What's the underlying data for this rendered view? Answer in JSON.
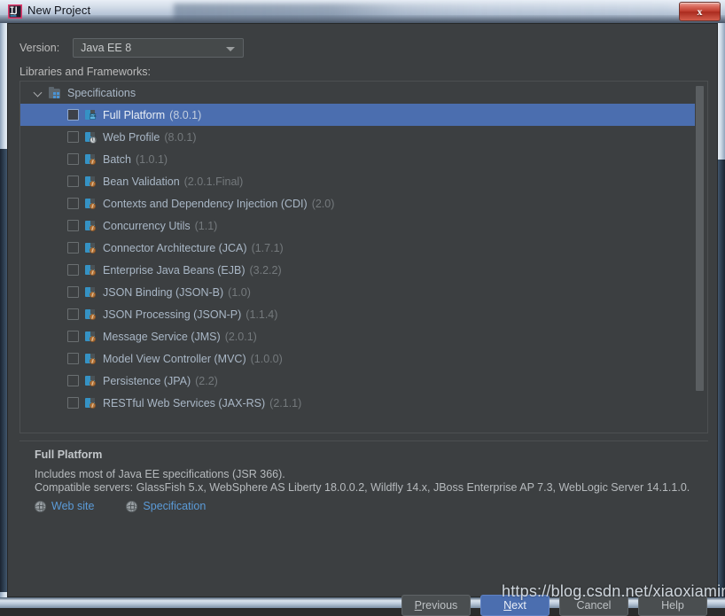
{
  "window": {
    "title": "New Project",
    "app_icon": "intellij-idea-icon",
    "close_label": "x"
  },
  "form": {
    "version_label": "Version:",
    "version_value": "Java EE 8",
    "libraries_label": "Libraries and Frameworks:"
  },
  "tree": {
    "group": {
      "label": "Specifications",
      "icon": "module-icon",
      "chevron": "chevron-down-icon"
    },
    "items": [
      {
        "name": "Full Platform",
        "version": "(8.0.1)",
        "icon": "platform-icon",
        "checked": false,
        "selected": true
      },
      {
        "name": "Web Profile",
        "version": "(8.0.1)",
        "icon": "web-profile-icon",
        "checked": false,
        "selected": false
      },
      {
        "name": "Batch",
        "version": "(1.0.1)",
        "icon": "spec-icon",
        "checked": false,
        "selected": false
      },
      {
        "name": "Bean Validation",
        "version": "(2.0.1.Final)",
        "icon": "spec-icon",
        "checked": false,
        "selected": false
      },
      {
        "name": "Contexts and Dependency Injection (CDI)",
        "version": "(2.0)",
        "icon": "spec-icon",
        "checked": false,
        "selected": false
      },
      {
        "name": "Concurrency Utils",
        "version": "(1.1)",
        "icon": "spec-icon",
        "checked": false,
        "selected": false
      },
      {
        "name": "Connector Architecture (JCA)",
        "version": "(1.7.1)",
        "icon": "spec-icon",
        "checked": false,
        "selected": false
      },
      {
        "name": "Enterprise Java Beans (EJB)",
        "version": "(3.2.2)",
        "icon": "spec-icon",
        "checked": false,
        "selected": false
      },
      {
        "name": "JSON Binding (JSON-B)",
        "version": "(1.0)",
        "icon": "spec-icon",
        "checked": false,
        "selected": false
      },
      {
        "name": "JSON Processing (JSON-P)",
        "version": "(1.1.4)",
        "icon": "spec-icon",
        "checked": false,
        "selected": false
      },
      {
        "name": "Message Service (JMS)",
        "version": "(2.0.1)",
        "icon": "spec-icon",
        "checked": false,
        "selected": false
      },
      {
        "name": "Model View Controller (MVC)",
        "version": "(1.0.0)",
        "icon": "spec-icon",
        "checked": false,
        "selected": false
      },
      {
        "name": "Persistence (JPA)",
        "version": "(2.2)",
        "icon": "spec-icon",
        "checked": false,
        "selected": false
      },
      {
        "name": "RESTful Web Services (JAX-RS)",
        "version": "(2.1.1)",
        "icon": "spec-icon",
        "checked": false,
        "selected": false
      }
    ]
  },
  "description": {
    "title": "Full Platform",
    "line1": "Includes most of Java EE specifications (JSR 366).",
    "line2": "Compatible servers: GlassFish 5.x, WebSphere AS Liberty 18.0.0.2, Wildfly 14.x, JBoss Enterprise AP 7.3, WebLogic Server 14.1.1.0.",
    "links": [
      {
        "label": "Web site",
        "icon": "globe-icon"
      },
      {
        "label": "Specification",
        "icon": "globe-icon"
      }
    ]
  },
  "buttons": [
    {
      "label": "Previous",
      "mnemonic": "P",
      "primary": false
    },
    {
      "label": "Next",
      "mnemonic": "N",
      "primary": true
    },
    {
      "label": "Cancel",
      "mnemonic": "",
      "primary": false
    },
    {
      "label": "Help",
      "mnemonic": "",
      "primary": false
    }
  ],
  "watermark": "https://blog.csdn.net/xiaoxiamimm",
  "colors": {
    "dialog_bg": "#3c3f41",
    "selection": "#4b6eaf",
    "text": "#a9b7c6",
    "muted": "#74797c",
    "link": "#5b9bd8",
    "spec_icon": "#3592c4"
  }
}
